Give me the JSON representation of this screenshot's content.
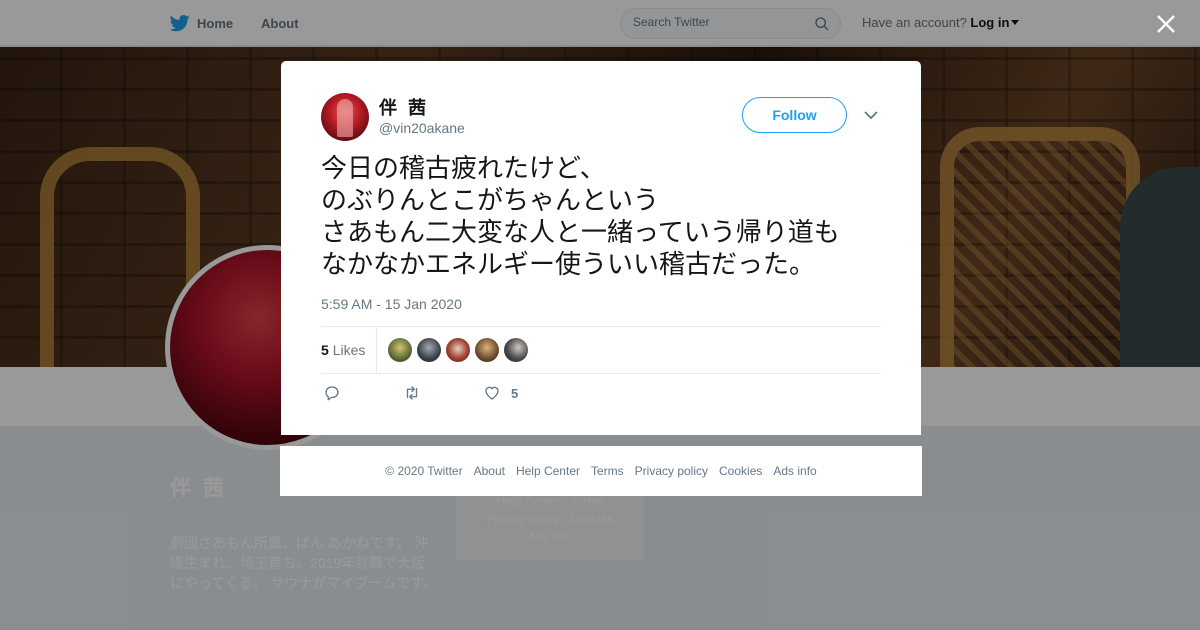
{
  "nav": {
    "home_label": "Home",
    "about_label": "About",
    "search_placeholder": "Search Twitter",
    "account_prompt": "Have an account?",
    "login_label": "Log in"
  },
  "profile": {
    "name": "伴 茜",
    "handle": "@vin20akane",
    "bio": "劇団さあもん所属、ばん あかねです。 沖縄生まれ、埼玉育ち。2019年就職で大阪にやってくる。 サウナがマイブームです。"
  },
  "mini_footer": {
    "links": [
      "Help Center",
      "Terms",
      "Privacy policy",
      "Cookies",
      "Ads info"
    ]
  },
  "tweet": {
    "author_name": "伴 茜",
    "author_handle": "@vin20akane",
    "follow_label": "Follow",
    "text": "今日の稽古疲れたけど、\nのぶりんとこがちゃんという\nさあもん二大変な人と一緒っていう帰り道も\nなかなかエネルギー使ういい稽古だった。",
    "timestamp": "5:59 AM - 15 Jan 2020",
    "likes_count": "5",
    "likes_label": "Likes",
    "like_action_count": "5",
    "liker_colors": [
      "#7a6a3a",
      "#3a4048",
      "#8a3a30",
      "#6a4a2a",
      "#2a2a2a"
    ]
  },
  "footer": {
    "copyright": "© 2020 Twitter",
    "about": "About",
    "help": "Help Center",
    "terms": "Terms",
    "privacy": "Privacy policy",
    "cookies": "Cookies",
    "ads": "Ads info"
  },
  "colors": {
    "accent": "#1da1f2",
    "text_secondary": "#657786"
  }
}
